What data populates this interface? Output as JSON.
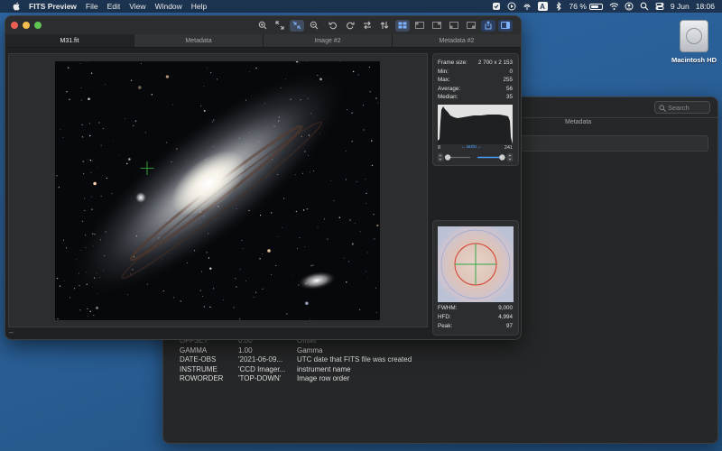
{
  "menubar": {
    "app_name": "FITS Preview",
    "menus": [
      "File",
      "Edit",
      "View",
      "Window",
      "Help"
    ],
    "battery_percent": "76 %",
    "battery_level": 0.76,
    "date": "9 Jun",
    "time": "18:06",
    "input_source": "A",
    "status_icons": [
      "checkbox-icon",
      "play-circle-icon",
      "airdrop-icon",
      "input-source-icon",
      "bluetooth-icon",
      "battery-icon",
      "wifi-icon",
      "user-icon",
      "search-icon",
      "control-center-icon"
    ]
  },
  "desktop": {
    "disk_label": "Macintosh HD"
  },
  "main_window": {
    "tabs": [
      "M31.fit",
      "Metadata",
      "Image #2",
      "Metadata #2"
    ],
    "active_tab": 0,
    "toolbar_icons": [
      "zoom-in-icon",
      "fit-window-icon",
      "actual-size-icon",
      "zoom-out-icon",
      "rotate-left-icon",
      "rotate-right-icon",
      "flip-horizontal-icon",
      "flip-vertical-icon",
      "grid-view-icon",
      "single-view-icon",
      "stats-view-icon",
      "compare-view-icon",
      "side-by-side-icon",
      "share-icon",
      "sidebar-toggle-icon"
    ],
    "status_text": "--"
  },
  "stats": {
    "frame_size_label": "Frame size:",
    "frame_size_value": "2 700 x 2 153",
    "min_label": "Min:",
    "min_value": "0",
    "max_label": "Max:",
    "max_value": "255",
    "average_label": "Average:",
    "average_value": "56",
    "median_label": "Median:",
    "median_value": "35",
    "histogram_min": "8",
    "histogram_max": "241",
    "auto_label": "←auto→",
    "black_point": 8,
    "white_point": 241
  },
  "psf": {
    "fwhm_label": "FWHM:",
    "fwhm_value": "9,000",
    "hfd_label": "HFD:",
    "hfd_value": "4,994",
    "peak_label": "Peak:",
    "peak_value": "97"
  },
  "metadata_window": {
    "search_placeholder": "Search",
    "tab_label": "Metadata",
    "rows": [
      {
        "key": "OFFSET",
        "value": "0.00",
        "comment": "Offset"
      },
      {
        "key": "GAMMA",
        "value": "1.00",
        "comment": "Gamma"
      },
      {
        "key": "DATE-OBS",
        "value": "'2021-06-09...",
        "comment": "UTC date that FITS file was created"
      },
      {
        "key": "INSTRUME",
        "value": "'CCD Imager...",
        "comment": "instrument name"
      },
      {
        "key": "ROWORDER",
        "value": "'TOP-DOWN'",
        "comment": "Image row order"
      }
    ]
  },
  "colors": {
    "desktop": "#2a5f97",
    "window_bg": "#202122",
    "accent_blue": "#4d9cf5",
    "traffic_close": "#ec5f57",
    "traffic_minimize": "#f4bd4f",
    "traffic_zoom": "#61c554"
  }
}
